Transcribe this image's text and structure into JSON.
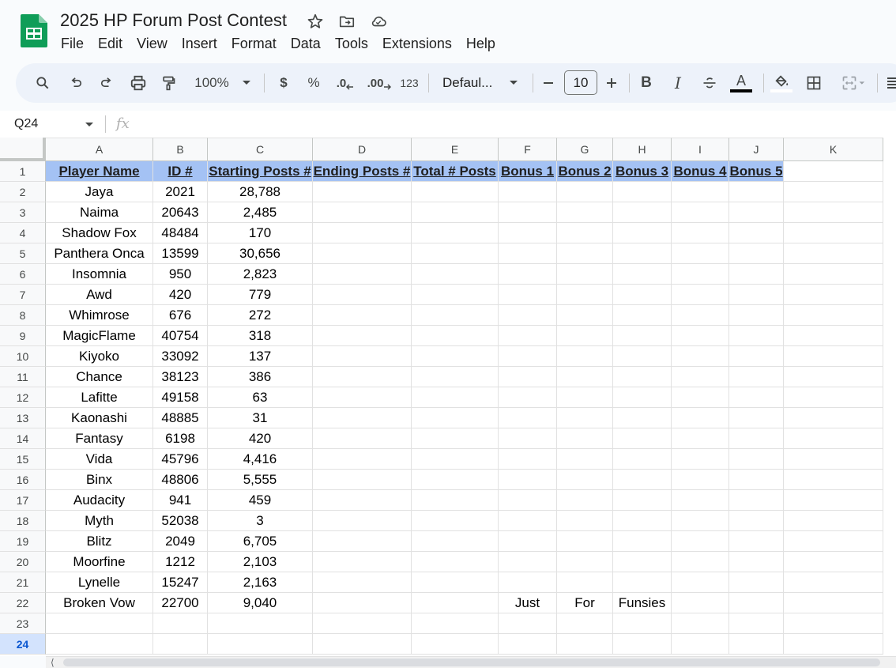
{
  "app": {
    "doc_title": "2025 HP Forum Post Contest",
    "menu": [
      "File",
      "Edit",
      "View",
      "Insert",
      "Format",
      "Data",
      "Tools",
      "Extensions",
      "Help"
    ]
  },
  "toolbar": {
    "zoom": "100%",
    "currency_label": "$",
    "percent_label": "%",
    "decrease_decimal_label": ".0",
    "increase_decimal_label": ".00",
    "more_formats_label": "123",
    "font_family": "Defaul...",
    "font_size": "10",
    "bold_label": "B",
    "italic_label": "I",
    "text_color_label": "A"
  },
  "formula_bar": {
    "name_box": "Q24",
    "fx_label": "fx",
    "value": ""
  },
  "grid": {
    "selected_row": 24,
    "columns": [
      "A",
      "B",
      "C",
      "D",
      "E",
      "F",
      "G",
      "H",
      "I",
      "J",
      "K"
    ],
    "row_numbers": [
      1,
      2,
      3,
      4,
      5,
      6,
      7,
      8,
      9,
      10,
      11,
      12,
      13,
      14,
      15,
      16,
      17,
      18,
      19,
      20,
      21,
      22,
      23,
      24
    ],
    "header_row": [
      "Player Name",
      "ID #",
      "Starting Posts #",
      "Ending Posts #",
      "Total # Posts",
      "Bonus 1",
      "Bonus 2",
      "Bonus 3",
      "Bonus 4",
      "Bonus 5"
    ],
    "rows": [
      [
        "Jaya",
        "2021",
        "28,788"
      ],
      [
        "Naima",
        "20643",
        "2,485"
      ],
      [
        "Shadow Fox",
        "48484",
        "170"
      ],
      [
        "Panthera Onca",
        "13599",
        "30,656"
      ],
      [
        "Insomnia",
        "950",
        "2,823"
      ],
      [
        "Awd",
        "420",
        "779"
      ],
      [
        "Whimrose",
        "676",
        "272"
      ],
      [
        "MagicFlame",
        "40754",
        "318"
      ],
      [
        "Kiyoko",
        "33092",
        "137"
      ],
      [
        "Chance",
        "38123",
        "386"
      ],
      [
        "Lafitte",
        "49158",
        "63"
      ],
      [
        "Kaonashi",
        "48885",
        "31"
      ],
      [
        "Fantasy",
        "6198",
        "420"
      ],
      [
        "Vida",
        "45796",
        "4,416"
      ],
      [
        "Binx",
        "48806",
        "5,555"
      ],
      [
        "Audacity",
        "941",
        "459"
      ],
      [
        "Myth",
        "52038",
        "3"
      ],
      [
        "Blitz",
        "2049",
        "6,705"
      ],
      [
        "Moorfine",
        "1212",
        "2,103"
      ],
      [
        "Lynelle",
        "15247",
        "2,163"
      ],
      [
        "Broken Vow",
        "22700",
        "9,040",
        "",
        "",
        "Just",
        "For",
        "Funsies"
      ]
    ],
    "header_fill": "#a4c2f4"
  },
  "icons": {
    "title": [
      "star-icon",
      "move-folder-icon",
      "cloud-saved-icon"
    ],
    "toolbar": [
      "search-icon",
      "undo-icon",
      "redo-icon",
      "print-icon",
      "paint-format-icon",
      "zoom-dropdown-icon",
      "font-dropdown-icon",
      "decrease-font-icon",
      "increase-font-icon",
      "strikethrough-icon",
      "fill-color-icon",
      "borders-icon",
      "merge-cells-icon",
      "align-icon"
    ]
  }
}
